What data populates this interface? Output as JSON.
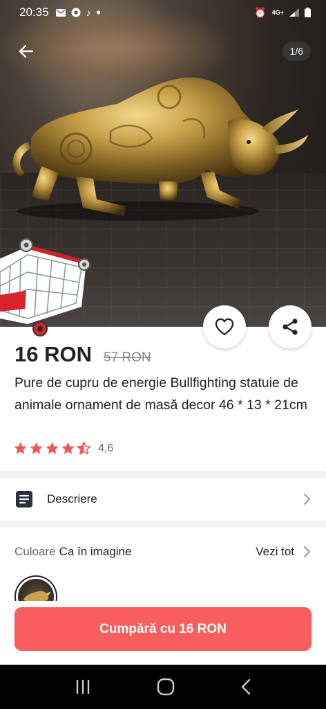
{
  "status_bar": {
    "time": "20:35",
    "network": "4G+"
  },
  "gallery": {
    "counter": "1/6"
  },
  "product": {
    "price": "16 RON",
    "old_price": "57 RON",
    "title": "Pure de cupru de energie Bullfighting statuie de animale ornament de masă decor 46 * 13 * 21cm",
    "rating_value": "4,6",
    "rating_stars": 4.6
  },
  "description": {
    "label": "Descriere"
  },
  "color": {
    "key": "Culoare",
    "value": "Ca în imagine",
    "see_all": "Vezi tot"
  },
  "buy_button": {
    "label": "Cumpără cu 16 RON"
  },
  "colors": {
    "accent": "#f85e5e",
    "star": "#f25656"
  }
}
